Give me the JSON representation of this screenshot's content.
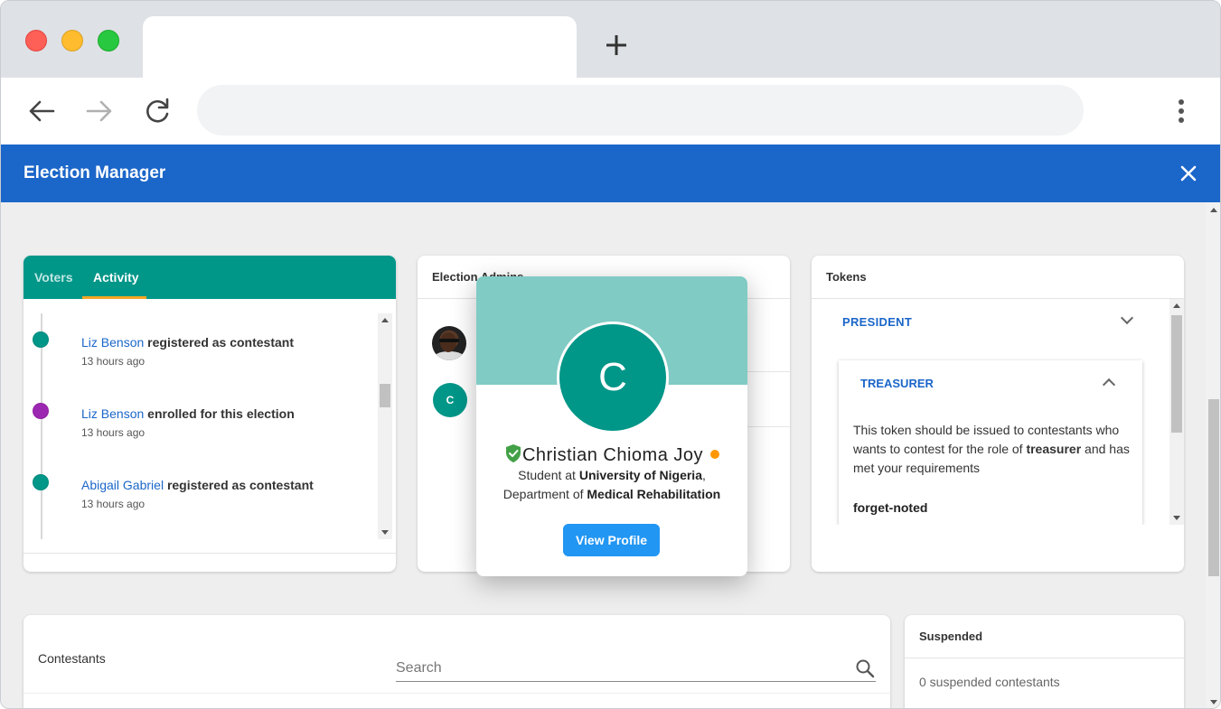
{
  "app": {
    "title": "Election Manager"
  },
  "activity_card": {
    "tabs": [
      {
        "label": "Voters",
        "active": false
      },
      {
        "label": "Activity",
        "active": true
      }
    ],
    "items": [
      {
        "name": "Liz Benson",
        "action": " registered as contestant",
        "time": "13 hours ago",
        "dot_color": "#009688"
      },
      {
        "name": "Liz Benson",
        "action": " enrolled for this election",
        "time": "13 hours ago",
        "dot_color": "#9c27b0"
      },
      {
        "name": "Abigail Gabriel",
        "action": " registered as contestant",
        "time": "13 hours ago",
        "dot_color": "#009688"
      }
    ]
  },
  "admins_card": {
    "title": "Election Admins",
    "avatar_initial": "C"
  },
  "tokens_card": {
    "title": "Tokens",
    "president_label": "PRESIDENT",
    "treasurer_label": "TREASURER",
    "description_before": "This token should be issued to contestants who wants to contest for the role of ",
    "description_bold": "treasurer",
    "description_after": " and has met your requirements",
    "token_code": "forget-noted"
  },
  "profile_popup": {
    "initial": "C",
    "name": "Christian Chioma Joy",
    "line1_prefix": "Student at ",
    "line1_bold": "University of Nigeria",
    "line1_suffix": ",",
    "line2_prefix": "Department of ",
    "line2_bold": "Medical Rehabilitation",
    "view_profile_label": "View Profile",
    "status_color": "#ff9800",
    "verified_color": "#43a047"
  },
  "contestants_card": {
    "title": "Contestants",
    "search_placeholder": "Search"
  },
  "suspended_card": {
    "title": "Suspended",
    "empty_text": "0 suspended contestants"
  },
  "colors": {
    "appbar": "#1b66c9",
    "teal": "#009688",
    "accent": "#f5a623",
    "link": "#1b66c9",
    "button": "#2196f3"
  }
}
